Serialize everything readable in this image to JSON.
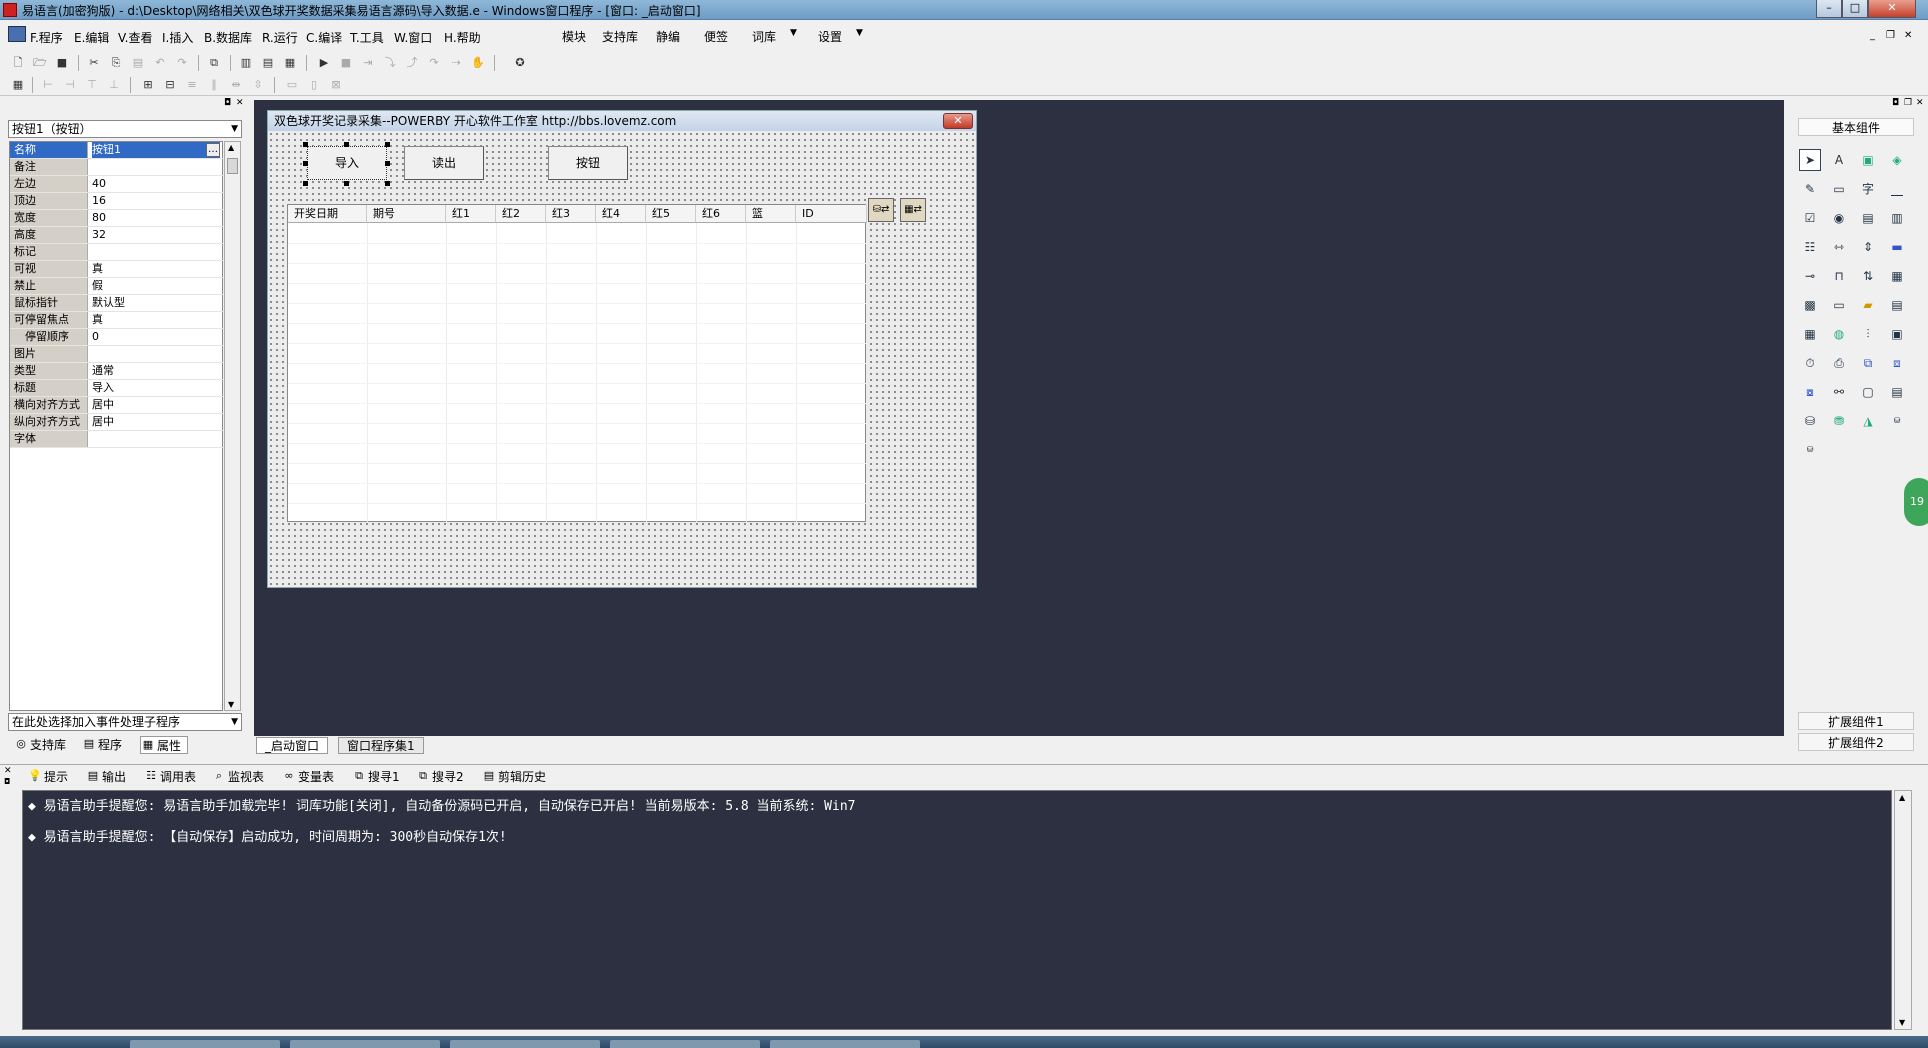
{
  "window": {
    "title": "易语言(加密狗版) - d:\\Desktop\\网络相关\\双色球开奖数据采集易语言源码\\导入数据.e - Windows窗口程序 - [窗口: _启动窗口]",
    "min": "–",
    "max": "□",
    "close": "✕"
  },
  "menu": {
    "items": [
      "F.程序",
      "E.编辑",
      "V.查看",
      "I.插入",
      "B.数据库",
      "R.运行",
      "C.编译",
      "T.工具",
      "W.窗口",
      "H.帮助"
    ],
    "extra": [
      "模块",
      "支持库",
      "静编",
      "便签",
      "词库",
      "设置"
    ],
    "arrow": "▼"
  },
  "left_panel": {
    "component_select": "按钮1（按钮）",
    "properties": [
      {
        "name": "名称",
        "value": "按钮1"
      },
      {
        "name": "备注",
        "value": ""
      },
      {
        "name": "左边",
        "value": "40"
      },
      {
        "name": "顶边",
        "value": "16"
      },
      {
        "name": "宽度",
        "value": "80"
      },
      {
        "name": "高度",
        "value": "32"
      },
      {
        "name": "标记",
        "value": ""
      },
      {
        "name": "可视",
        "value": "真"
      },
      {
        "name": "禁止",
        "value": "假"
      },
      {
        "name": "鼠标指针",
        "value": "默认型"
      },
      {
        "name": "可停留焦点",
        "value": "真"
      },
      {
        "name": "　停留顺序",
        "value": "0"
      },
      {
        "name": "图片",
        "value": ""
      },
      {
        "name": "类型",
        "value": "通常"
      },
      {
        "name": "标题",
        "value": "导入"
      },
      {
        "name": "横向对齐方式",
        "value": "居中"
      },
      {
        "name": "纵向对齐方式",
        "value": "居中"
      },
      {
        "name": "字体",
        "value": ""
      }
    ],
    "event_select": "在此处选择加入事件处理子程序",
    "tabs": [
      "支持库",
      "程序",
      "属性"
    ]
  },
  "form": {
    "title": "双色球开奖记录采集--POWERBY 开心软件工作室 http://bbs.lovemz.com",
    "buttons": [
      "导入",
      "读出",
      "按钮"
    ],
    "grid_headers": [
      "开奖日期",
      "期号",
      "红1",
      "红2",
      "红3",
      "红4",
      "红5",
      "红6",
      "篮",
      "ID"
    ]
  },
  "design_tabs": [
    "_启动窗口",
    "窗口程序集1"
  ],
  "right_panel": {
    "title": "基本组件",
    "ext1": "扩展组件1",
    "ext2": "扩展组件2"
  },
  "output": {
    "tabs": [
      "提示",
      "输出",
      "调用表",
      "监视表",
      "变量表",
      "搜寻1",
      "搜寻2",
      "剪辑历史"
    ],
    "lines": [
      "◆ 易语言助手提醒您:  易语言助手加载完毕! 词库功能[关闭], 自动备份源码已开启, 自动保存已开启!  当前易版本: 5.8  当前系统: Win7",
      "◆ 易语言助手提醒您: 【自动保存】启动成功, 时间周期为: 300秒自动保存1次!"
    ]
  },
  "float_badge": "19"
}
